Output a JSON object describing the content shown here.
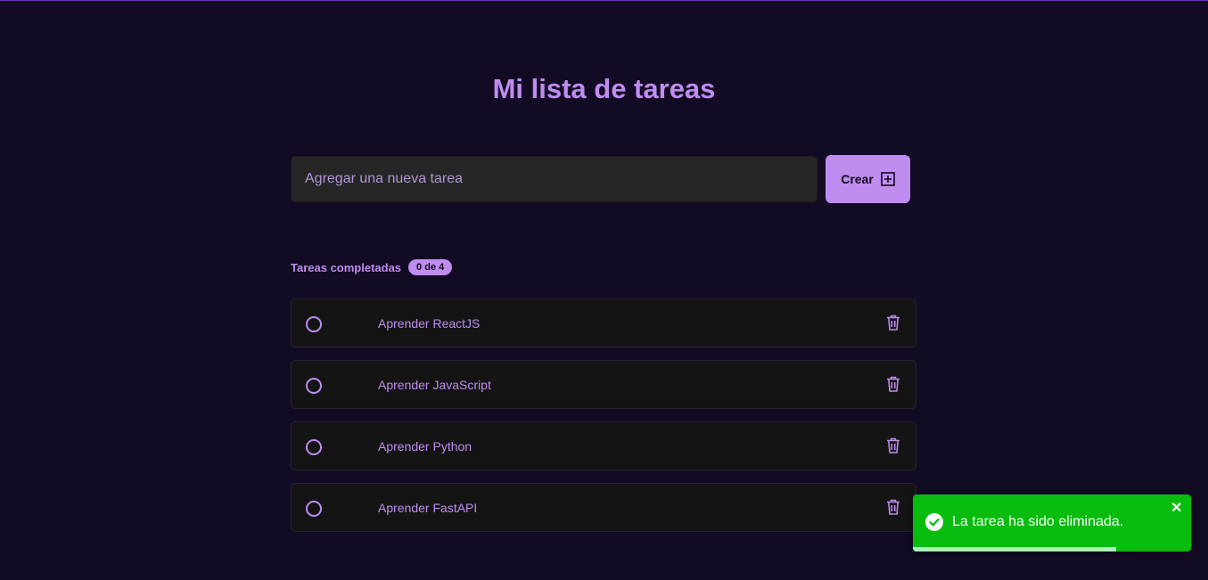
{
  "header": {
    "title": "Mi lista de tareas"
  },
  "form": {
    "placeholder": "Agregar una nueva tarea",
    "create_label": "Crear"
  },
  "summary": {
    "label": "Tareas completadas",
    "badge": "0 de 4"
  },
  "tasks": [
    {
      "label": "Aprender ReactJS",
      "completed": false
    },
    {
      "label": "Aprender JavaScript",
      "completed": false
    },
    {
      "label": "Aprender Python",
      "completed": false
    },
    {
      "label": "Aprender FastAPI",
      "completed": false
    }
  ],
  "toast": {
    "message": "La tarea ha sido eliminada.",
    "type": "success",
    "progress": 0.73
  },
  "colors": {
    "accent": "#bf8cf0",
    "background": "#130a24",
    "success": "#07bc0c"
  }
}
